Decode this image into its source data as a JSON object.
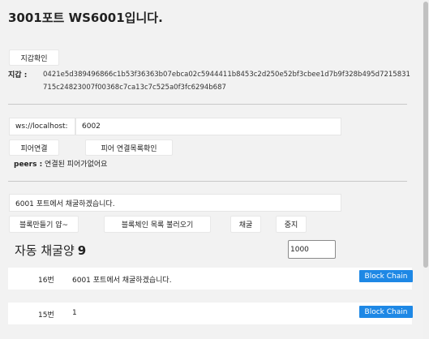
{
  "header": {
    "title": "3001포트 WS6001입니다."
  },
  "wallet": {
    "check_button": "지갑확인",
    "label": "지갑 :",
    "address": "0421e5d389496866c1b53f36363b07ebca02c5944411b8453c2d250e52bf3cbee1d7b9f328b495d7215831715c24823007f00368c7ca13c7c525a0f3fc6294b687"
  },
  "peer": {
    "url_prefix": "ws://localhost:",
    "port_value": "6002",
    "connect_button": "피어연결",
    "list_button": "피어 연결목록확인",
    "peers_label": "peers :",
    "peers_status": " 연결된 피어가없어요"
  },
  "mining": {
    "message_value": "6001 포트에서 채굴하겠습니다.",
    "make_block_button": "블록만들기 얍~",
    "load_chain_button": "블록체인 목록 불러오기",
    "mine_button": "채굴",
    "stop_button": "중지",
    "auto_label": "자동 채굴양",
    "auto_count": "9",
    "auto_input_value": "1000"
  },
  "blocks": [
    {
      "index": "16번",
      "data": "6001 포트에서 채굴하겠습니다.",
      "button": "Block Chain"
    },
    {
      "index": "15번",
      "data": "1",
      "button": "Block Chain"
    }
  ]
}
